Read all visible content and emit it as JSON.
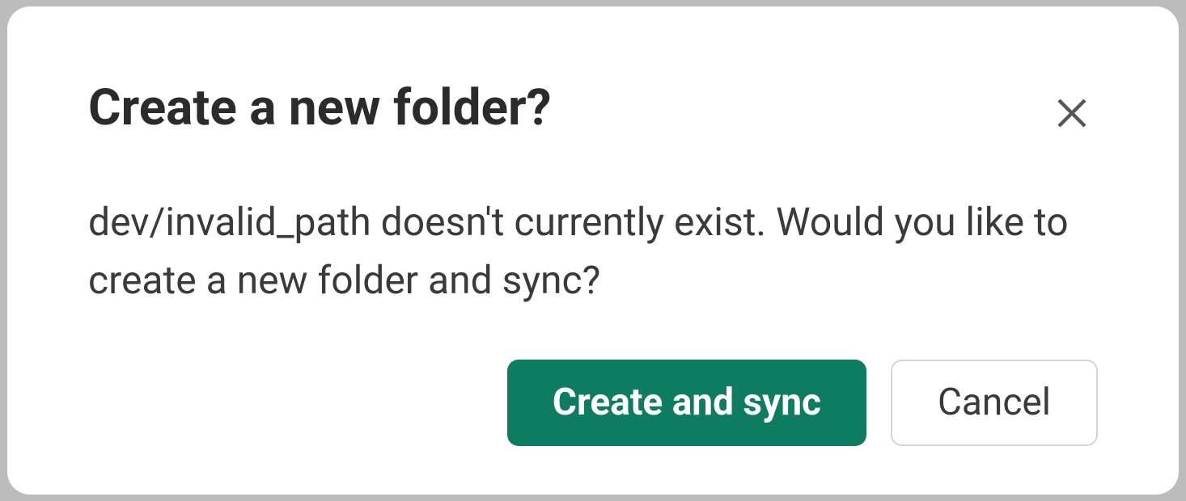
{
  "dialog": {
    "title": "Create a new folder?",
    "message": "dev/invalid_path doesn't currently exist. Would you like to create a new folder and sync?",
    "primary_label": "Create and sync",
    "secondary_label": "Cancel"
  }
}
